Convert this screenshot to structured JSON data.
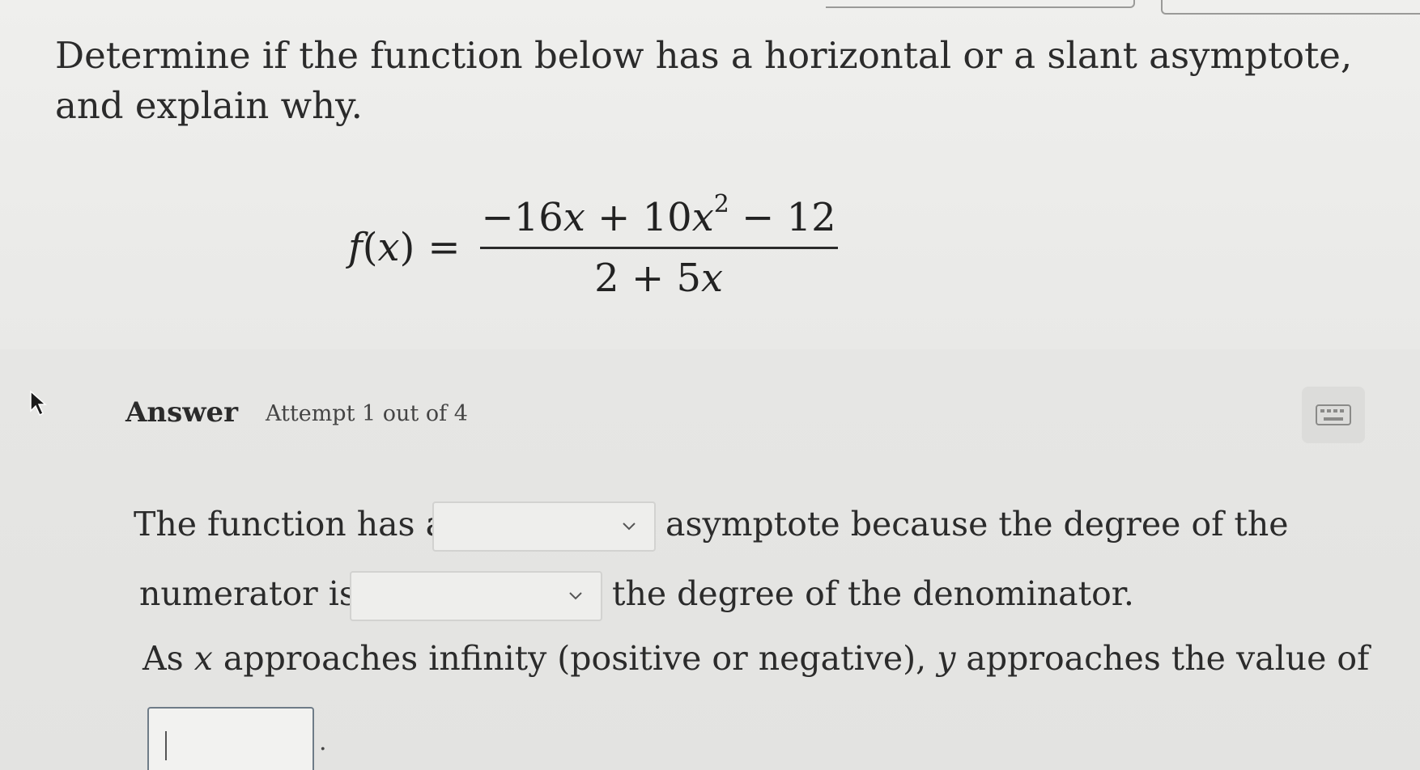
{
  "question": {
    "text": "Determine if the function below has a horizontal or a slant asymptote, and explain why."
  },
  "formula": {
    "lhs_name": "f",
    "lhs_var": "x",
    "equals": "=",
    "numerator_part1": "−16",
    "numerator_var1": "x",
    "numerator_part2": " + 10",
    "numerator_var2": "x",
    "numerator_exponent": "2",
    "numerator_part3": " − 12",
    "denominator_part1": "2 + 5",
    "denominator_var": "x"
  },
  "answer": {
    "label": "Answer",
    "attempt": "Attempt 1 out of 4",
    "keyboard_icon": "keyboard-icon"
  },
  "sentence": {
    "line1_before": "The function has a",
    "line1_after": "asymptote because the degree of the",
    "line2_before": "numerator is",
    "line2_after": "the degree of the denominator.",
    "line3_as": "As",
    "line3_x": "x",
    "line3_mid": "approaches infinity (positive or negative),",
    "line3_y": "y",
    "line3_end": "approaches the value of",
    "period": "."
  },
  "dropdowns": {
    "asymptote_type": {
      "selected": ""
    },
    "degree_comparison": {
      "selected": ""
    }
  },
  "inputs": {
    "limit_value": ""
  },
  "colors": {
    "background": "#ececea",
    "text": "#2b2b2b",
    "input_border": "#6f7c88"
  }
}
